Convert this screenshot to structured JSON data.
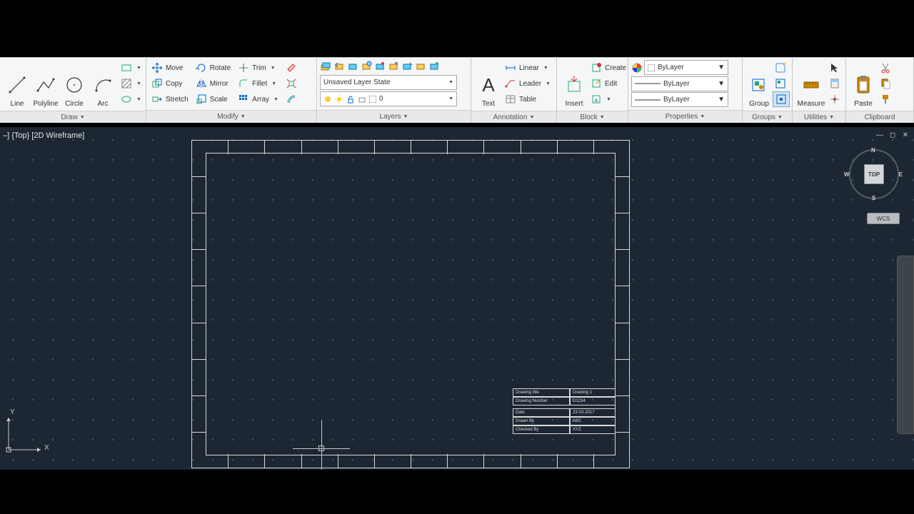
{
  "ribbon": {
    "panels": {
      "draw": {
        "title": "Draw",
        "line": "Line",
        "polyline": "Polyline",
        "circle": "Circle",
        "arc": "Arc"
      },
      "modify": {
        "title": "Modify",
        "move": "Move",
        "copy": "Copy",
        "stretch": "Stretch",
        "rotate": "Rotate",
        "mirror": "Mirror",
        "scale": "Scale",
        "trim": "Trim",
        "fillet": "Fillet",
        "array": "Array"
      },
      "layers": {
        "title": "Layers",
        "state": "Unsaved Layer State",
        "current": "0"
      },
      "annotation": {
        "title": "Annotation",
        "text": "Text",
        "linear": "Linear",
        "leader": "Leader",
        "table": "Table"
      },
      "block": {
        "title": "Block",
        "insert": "Insert",
        "create": "Create",
        "edit": "Edit"
      },
      "properties": {
        "title": "Properties",
        "color": "ByLayer",
        "lineweight": "ByLayer",
        "linetype": "ByLayer"
      },
      "groups": {
        "title": "Groups",
        "group": "Group"
      },
      "utilities": {
        "title": "Utilities",
        "measure": "Measure"
      },
      "clipboard": {
        "title": "Clipboard",
        "paste": "Paste"
      }
    }
  },
  "viewport": {
    "label": "–] {Top} [2D Wireframe]",
    "cube_face": "TOP",
    "cube_dirs": {
      "n": "N",
      "s": "S",
      "e": "E",
      "w": "W"
    },
    "wcs": "WCS",
    "ucs_x": "X",
    "ucs_y": "Y"
  },
  "titleblock": {
    "r0l": "Drawing title",
    "r0v": "Drawing 1",
    "r1l": "Drawing Number",
    "r1v": "D1234",
    "r2l": "Date",
    "r2v": "23-03-2017",
    "r3l": "Drawn By",
    "r3v": "ABC",
    "r4l": "Checked By",
    "r4v": "XYZ"
  }
}
